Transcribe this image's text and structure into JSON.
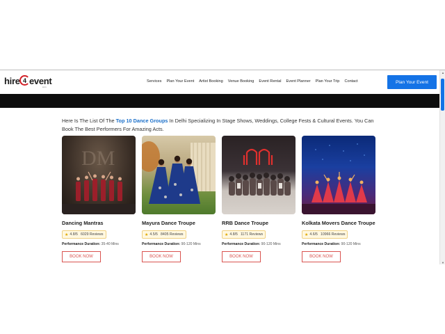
{
  "header": {
    "logo": {
      "part1": "hire",
      "num": "4",
      "part2": "event",
      "sub": ".com"
    },
    "nav": [
      "Services",
      "Plan Your Event",
      "Artist Booking",
      "Venue Booking",
      "Event Rental",
      "Event Planner",
      "Plan Your Trip",
      "Contact"
    ],
    "cta": "Plan Your Event",
    "accent": "#1473e6"
  },
  "intro": {
    "before": "Here Is The List Of The ",
    "highlight": "Top 10 Dance Groups",
    "after": " In Delhi Specializing In Stage Shows, Weddings, College Fests & Cultural Events. You Can Book The Best Performers For Amazing Acts."
  },
  "cards": [
    {
      "title": "Dancing Mantras",
      "rating": "4.8/5",
      "reviews": "6029 Reviews",
      "duration_label": "Performance Duration:",
      "duration": "35-40 Mins",
      "button": "BOOK NOW"
    },
    {
      "title": "Mayura Dance Troupe",
      "rating": "4.5/5",
      "reviews": "8405 Reviews",
      "duration_label": "Performance Duration:",
      "duration": "90-120 Mins",
      "button": "BOOK NOW"
    },
    {
      "title": "RRB Dance Troupe",
      "rating": "4.8/5",
      "reviews": "1171 Reviews",
      "duration_label": "Performance Duration:",
      "duration": "90-120 Mins",
      "button": "BOOK NOW"
    },
    {
      "title": "Kolkata Movers Dance Troupe",
      "rating": "4.6/5",
      "reviews": "10966 Reviews",
      "duration_label": "Performance Duration:",
      "duration": "90-120 Mins",
      "button": "BOOK NOW"
    }
  ]
}
